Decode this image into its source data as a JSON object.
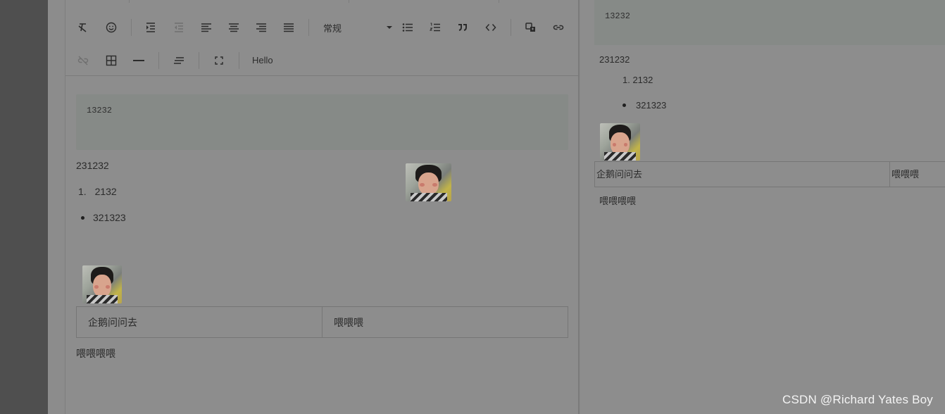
{
  "toolbar": {
    "row1": [
      {
        "icon": "clear-format-icon"
      },
      {
        "icon": "emoji-icon"
      },
      {
        "icon": "indent-icon"
      },
      {
        "icon": "outdent-icon"
      },
      {
        "icon": "align-left-icon"
      },
      {
        "icon": "align-center-icon"
      },
      {
        "icon": "align-right-icon"
      },
      {
        "icon": "align-justify-icon"
      },
      {
        "icon": "bulleted-list-icon"
      },
      {
        "icon": "numbered-list-icon"
      },
      {
        "icon": "quote-icon"
      },
      {
        "icon": "code-icon"
      },
      {
        "icon": "insert-image-icon"
      },
      {
        "icon": "link-icon"
      }
    ],
    "heading_select": "常规",
    "row2": [
      {
        "icon": "unlink-icon"
      },
      {
        "icon": "table-icon"
      },
      {
        "icon": "horizontal-rule-icon"
      },
      {
        "icon": "line-height-icon"
      },
      {
        "icon": "fullscreen-icon"
      }
    ],
    "custom_button": "Hello"
  },
  "editor": {
    "code_block": "13232",
    "paragraph": "231232",
    "ordered_list": [
      {
        "number": "1.",
        "text": "2132"
      }
    ],
    "bullet_list": [
      "321323"
    ],
    "table": {
      "rows": [
        [
          "企鹅问问去",
          "喂喂喂"
        ]
      ]
    },
    "last_paragraph": "喂喂喂喂"
  },
  "preview": {
    "code_block": "13232",
    "paragraph": "231232",
    "ordered_item": "1. 2132",
    "bullet_item": "321323",
    "table": {
      "rows": [
        [
          "企鹅问问去",
          "喂喂喂"
        ]
      ]
    },
    "last_paragraph": "喂喂喂喂"
  },
  "watermark": "CSDN @Richard Yates Boy"
}
